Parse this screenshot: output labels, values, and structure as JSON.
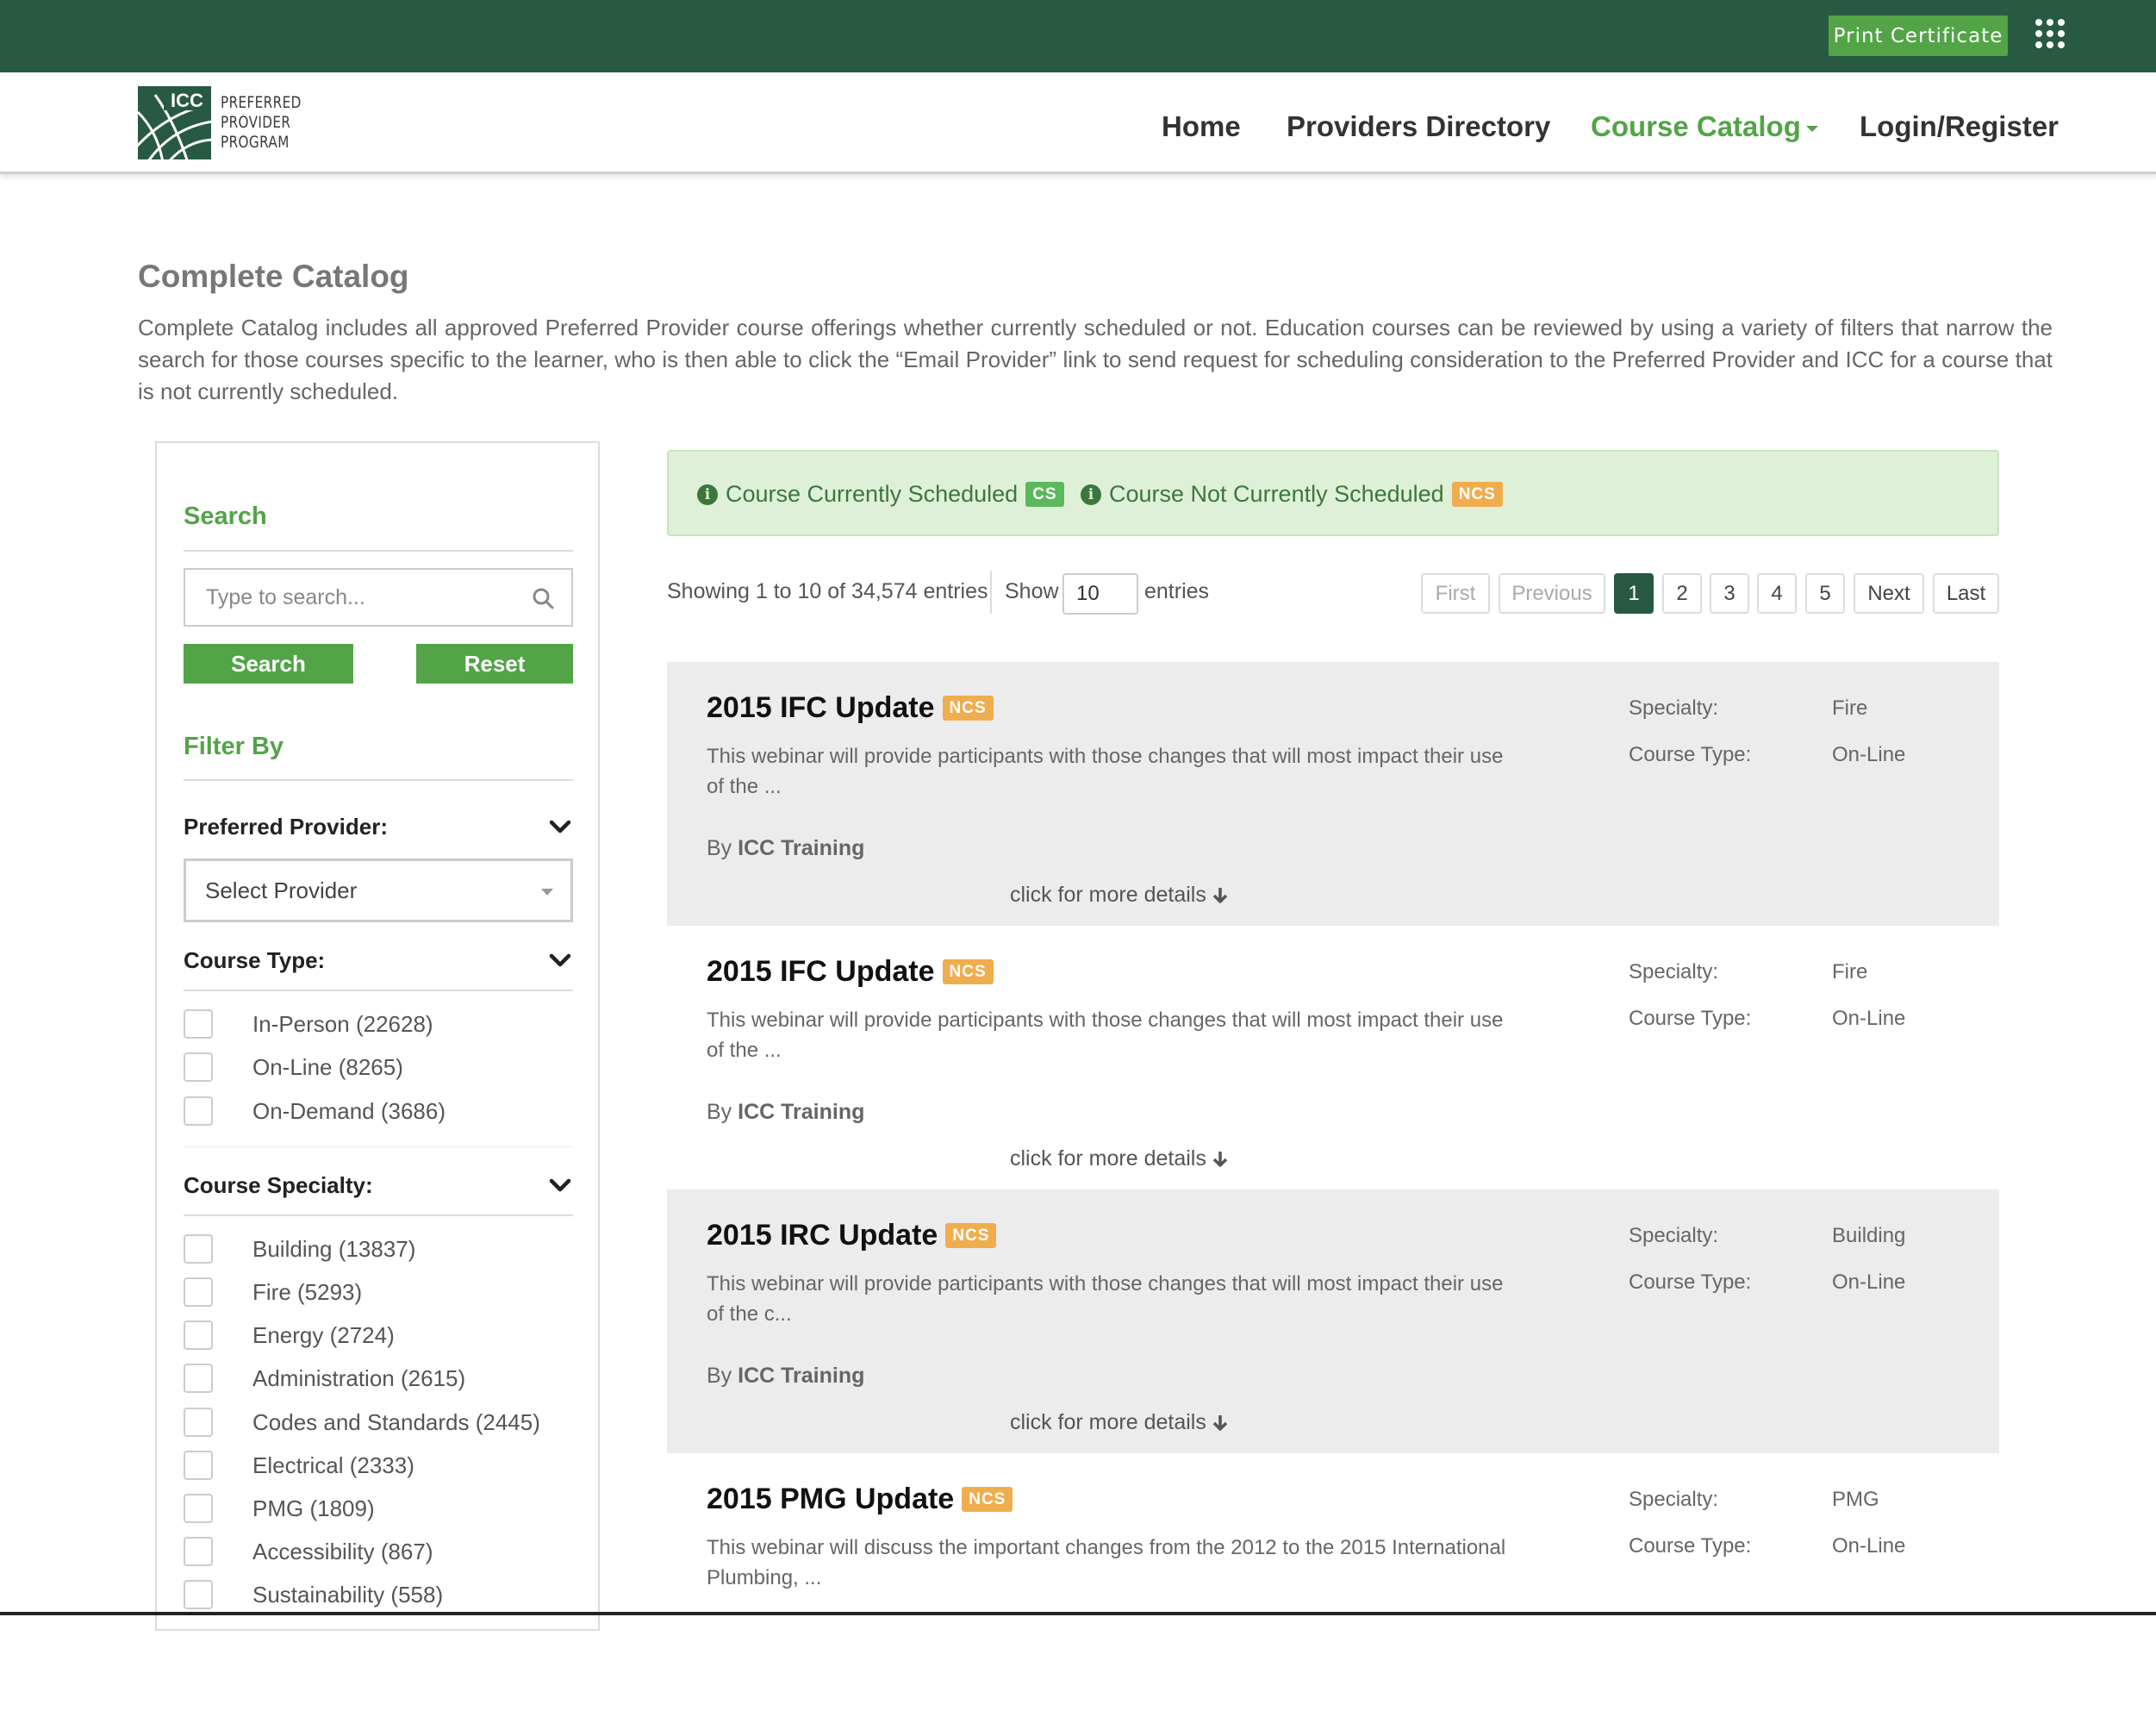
{
  "topbar": {
    "print_certificate": "Print Certificate",
    "apps_icon": "grid-menu-icon"
  },
  "brand": {
    "logo_icon": "icc-globe-logo",
    "logo_abbrev": "ICC",
    "logo_line1": "PREFERRED",
    "logo_line2": "PROVIDER",
    "logo_line3": "PROGRAM"
  },
  "nav": {
    "home": "Home",
    "providers_directory": "Providers Directory",
    "course_catalog": "Course Catalog",
    "login_register": "Login/Register"
  },
  "intro": {
    "title": "Complete Catalog",
    "text": "Complete Catalog includes all approved Preferred Provider course offerings whether currently scheduled or not. Education courses can be reviewed by using a variety of filters that narrow the search for those courses specific to the learner, who is then able to click the “Email Provider” link to send request for scheduling consideration to the Preferred Provider and ICC for a course that is not currently scheduled."
  },
  "sidebar": {
    "search_heading": "Search",
    "search_placeholder": "Type to search...",
    "search_button": "Search",
    "reset_button": "Reset",
    "filter_heading": "Filter By",
    "provider_label": "Preferred Provider:",
    "provider_select": "Select Provider",
    "course_type_label": "Course Type:",
    "course_types": [
      {
        "label": "In-Person (22628)"
      },
      {
        "label": "On-Line (8265)"
      },
      {
        "label": "On-Demand (3686)"
      }
    ],
    "specialty_label": "Course Specialty:",
    "specialties": [
      {
        "label": "Building (13837)"
      },
      {
        "label": "Fire (5293)"
      },
      {
        "label": "Energy (2724)"
      },
      {
        "label": "Administration (2615)"
      },
      {
        "label": "Codes and Standards (2445)"
      },
      {
        "label": "Electrical (2333)"
      },
      {
        "label": "PMG (1809)"
      },
      {
        "label": "Accessibility (867)"
      },
      {
        "label": "Sustainability (558)"
      }
    ]
  },
  "legend": {
    "scheduled": "Course Currently Scheduled",
    "scheduled_badge": "CS",
    "not_scheduled": "Course Not Currently Scheduled",
    "not_scheduled_badge": "NCS",
    "scheduled_color": "#5cb85c",
    "not_scheduled_color": "#f0ad4e"
  },
  "table": {
    "showing": "Showing 1 to 10 of 34,574 entries",
    "show_label": "Show",
    "entries_value": "10",
    "entries_label": "entries"
  },
  "pagination": {
    "first": "First",
    "previous": "Previous",
    "pages": [
      "1",
      "2",
      "3",
      "4",
      "5"
    ],
    "current": "1",
    "next": "Next",
    "last": "Last"
  },
  "courses": [
    {
      "title": "2015 IFC Update",
      "badge": "NCS",
      "desc": "This webinar will provide participants with those changes that will most impact their use of the ...",
      "by_prefix": "By",
      "provider": "ICC Training",
      "more": "click for more details",
      "specialty_label": "Specialty:",
      "specialty": "Fire",
      "type_label": "Course Type:",
      "type": "On-Line"
    },
    {
      "title": "2015 IFC Update",
      "badge": "NCS",
      "desc": "This webinar will provide participants with those changes that will most impact their use of the ...",
      "by_prefix": "By",
      "provider": "ICC Training",
      "more": "click for more details",
      "specialty_label": "Specialty:",
      "specialty": "Fire",
      "type_label": "Course Type:",
      "type": "On-Line"
    },
    {
      "title": "2015 IRC Update",
      "badge": "NCS",
      "desc": "This webinar will provide participants with those changes that will most impact their use of the c...",
      "by_prefix": "By",
      "provider": "ICC Training",
      "more": "click for more details",
      "specialty_label": "Specialty:",
      "specialty": "Building",
      "type_label": "Course Type:",
      "type": "On-Line"
    },
    {
      "title": "2015 PMG Update",
      "badge": "NCS",
      "desc": "This webinar will discuss the important changes from the 2012 to the 2015 International Plumbing, ...",
      "specialty_label": "Specialty:",
      "specialty": "PMG",
      "type_label": "Course Type:",
      "type": "On-Line"
    }
  ]
}
